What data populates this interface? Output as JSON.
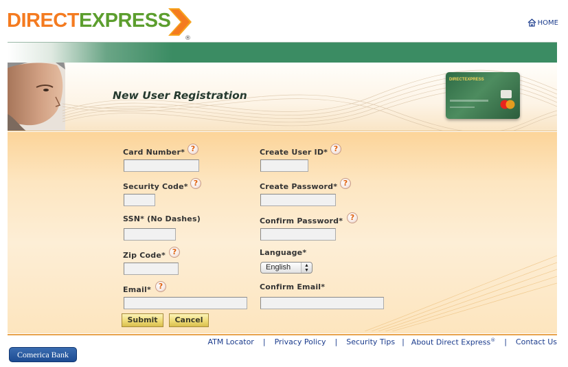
{
  "header": {
    "logo_direct": "DIRECT",
    "logo_express": "EXPRESS",
    "logo_reg": "®",
    "home_label": "HOME"
  },
  "hero": {
    "title": "New User Registration",
    "card_logo": "DIRECTEXPRESS"
  },
  "form": {
    "card_number_label": "Card Number*",
    "security_code_label": "Security Code*",
    "ssn_label": "SSN* (No Dashes)",
    "zip_label": "Zip Code*",
    "email_label": "Email*",
    "user_id_label": "Create User ID*",
    "password_label": "Create Password*",
    "confirm_password_label": "Confirm Password*",
    "language_label": "Language*",
    "language_value": "English",
    "confirm_email_label": "Confirm Email*",
    "help_glyph": "?",
    "submit_label": "Submit",
    "cancel_label": "Cancel"
  },
  "footer": {
    "links": [
      "ATM Locator",
      "Privacy Policy",
      "Security Tips",
      "About Direct Express",
      "Contact Us"
    ],
    "separator": "|",
    "about_reg": "®",
    "bank_name": "Comerica Bank"
  },
  "colors": {
    "orange": "#f47b20",
    "green": "#5c9e2e",
    "link_blue": "#1a3b8c",
    "bar_green": "#3b8c63"
  },
  "icons": {
    "home": "home-icon",
    "help": "question-mark-icon"
  }
}
